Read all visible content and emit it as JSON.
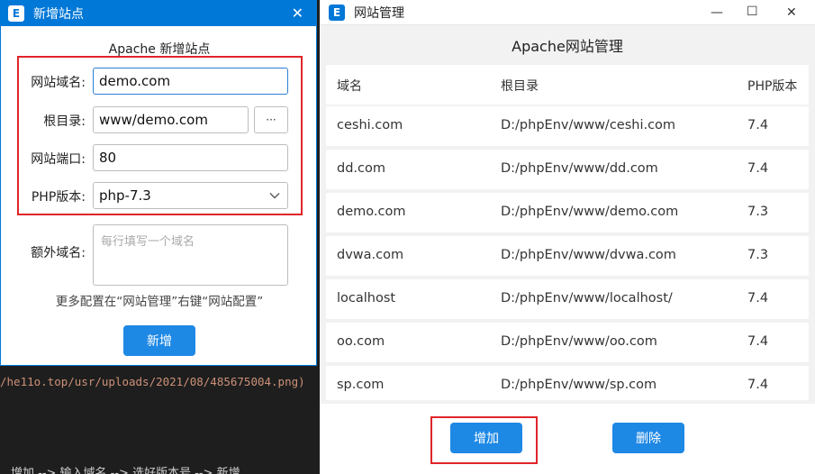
{
  "terminal": {
    "url_line": "/he11o.top/usr/uploads/2021/08/485675004.png)",
    "bottom_line": "增加 --> 输入域名 --> 选好版本号 --> 新增"
  },
  "add_site_window": {
    "title": "新增站点",
    "close": "✕",
    "form_title": "Apache 新增站点",
    "domain_label": "网站域名:",
    "domain_value": "demo.com",
    "root_label": "根目录:",
    "root_value": "www/demo.com",
    "browse_label": "···",
    "port_label": "网站端口:",
    "port_value": "80",
    "php_label": "PHP版本:",
    "php_value": "php-7.3",
    "extra_label": "额外域名:",
    "extra_placeholder": "每行填写一个域名",
    "hint": "更多配置在“网站管理”右键“网站配置”",
    "submit_label": "新增"
  },
  "site_manager_window": {
    "title": "网站管理",
    "minimize": "—",
    "maximize": "☐",
    "close": "✕",
    "heading": "Apache网站管理",
    "columns": [
      "域名",
      "根目录",
      "PHP版本"
    ],
    "rows": [
      {
        "domain": "ceshi.com",
        "root": "D:/phpEnv/www/ceshi.com",
        "php": "7.4"
      },
      {
        "domain": "dd.com",
        "root": "D:/phpEnv/www/dd.com",
        "php": "7.4"
      },
      {
        "domain": "demo.com",
        "root": "D:/phpEnv/www/demo.com",
        "php": "7.3"
      },
      {
        "domain": "dvwa.com",
        "root": "D:/phpEnv/www/dvwa.com",
        "php": "7.3"
      },
      {
        "domain": "localhost",
        "root": "D:/phpEnv/www/localhost/",
        "php": "7.4"
      },
      {
        "domain": "oo.com",
        "root": "D:/phpEnv/www/oo.com",
        "php": "7.4"
      },
      {
        "domain": "sp.com",
        "root": "D:/phpEnv/www/sp.com",
        "php": "7.4"
      }
    ],
    "add_label": "增加",
    "delete_label": "删除"
  },
  "colors": {
    "accent": "#1e88e5",
    "titlebar": "#0078d7",
    "highlight": "#e0252a"
  }
}
